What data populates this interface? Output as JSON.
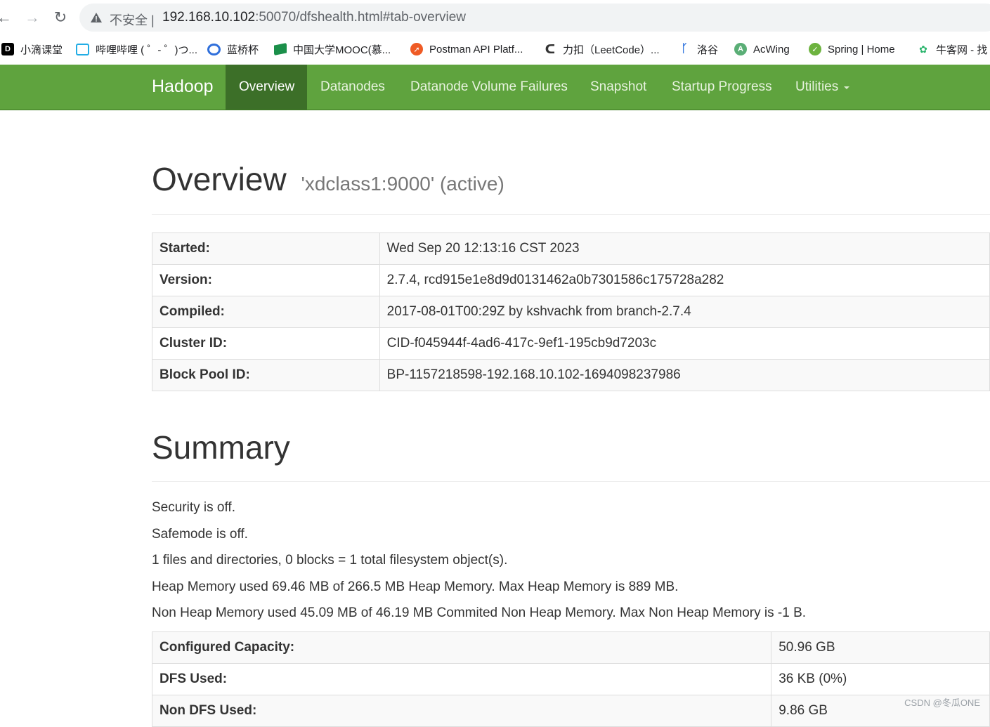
{
  "browser": {
    "security_label": "不安全",
    "url_host": "192.168.10.102",
    "url_rest": ":50070/dfshealth.html#tab-overview"
  },
  "bookmarks": [
    {
      "label": "小滴课堂",
      "icon": "xiaodi-icon",
      "color": "#000000"
    },
    {
      "label": "哔哩哔哩 ( ゜- ゜)つ...",
      "icon": "bilibili-icon",
      "color": "#23ade5"
    },
    {
      "label": "蓝桥杯",
      "icon": "lanqiao-icon",
      "color": "#2f6fdb"
    },
    {
      "label": "中国大学MOOC(慕...",
      "icon": "mooc-icon",
      "color": "#1b8f4a"
    },
    {
      "label": "Postman API Platf...",
      "icon": "postman-icon",
      "color": "#ef5b25"
    },
    {
      "label": "力扣（LeetCode）...",
      "icon": "leetcode-icon",
      "color": "#f0a31b"
    },
    {
      "label": "洛谷",
      "icon": "luogu-icon",
      "color": "#3a7be0"
    },
    {
      "label": "AcWing",
      "icon": "acwing-icon",
      "color": "#5aae76"
    },
    {
      "label": "Spring | Home",
      "icon": "spring-icon",
      "color": "#6db33f"
    },
    {
      "label": "牛客网 - 找",
      "icon": "nowcoder-icon",
      "color": "#27b36a"
    }
  ],
  "navbar": {
    "brand": "Hadoop",
    "items": [
      {
        "label": "Overview",
        "active": true
      },
      {
        "label": "Datanodes",
        "active": false
      },
      {
        "label": "Datanode Volume Failures",
        "active": false
      },
      {
        "label": "Snapshot",
        "active": false
      },
      {
        "label": "Startup Progress",
        "active": false
      },
      {
        "label": "Utilities",
        "active": false
      }
    ]
  },
  "overview": {
    "title": "Overview",
    "subtitle": "'xdclass1:9000' (active)",
    "rows": [
      {
        "key": "Started:",
        "value": "Wed Sep 20 12:13:16 CST 2023"
      },
      {
        "key": "Version:",
        "value": "2.7.4, rcd915e1e8d9d0131462a0b7301586c175728a282"
      },
      {
        "key": "Compiled:",
        "value": "2017-08-01T00:29Z by kshvachk from branch-2.7.4"
      },
      {
        "key": "Cluster ID:",
        "value": "CID-f045944f-4ad6-417c-9ef1-195cb9d7203c"
      },
      {
        "key": "Block Pool ID:",
        "value": "BP-1157218598-192.168.10.102-1694098237986"
      }
    ]
  },
  "summary": {
    "title": "Summary",
    "lines": [
      "Security is off.",
      "Safemode is off.",
      "1 files and directories, 0 blocks = 1 total filesystem object(s).",
      "Heap Memory used 69.46 MB of 266.5 MB Heap Memory. Max Heap Memory is 889 MB.",
      "Non Heap Memory used 45.09 MB of 46.19 MB Commited Non Heap Memory. Max Non Heap Memory is -1 B."
    ],
    "rows": [
      {
        "key": "Configured Capacity:",
        "value": "50.96 GB"
      },
      {
        "key": "DFS Used:",
        "value": "36 KB (0%)"
      },
      {
        "key": "Non DFS Used:",
        "value": "9.86 GB"
      }
    ]
  },
  "watermark": "CSDN @冬瓜ONE"
}
